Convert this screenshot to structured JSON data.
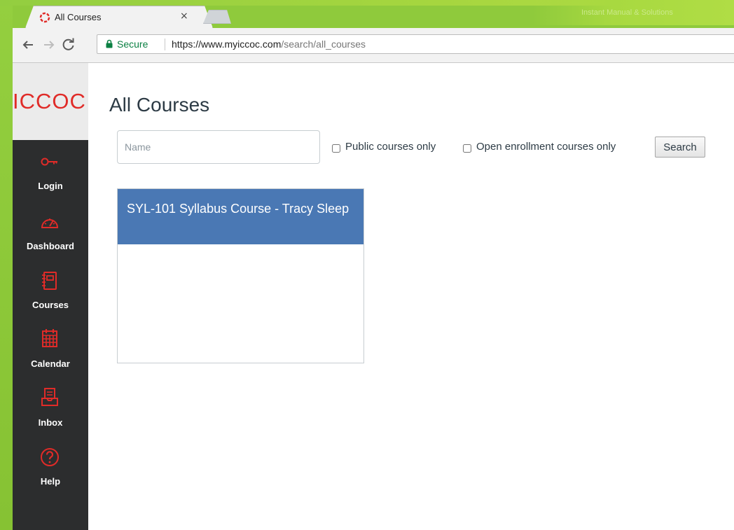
{
  "browser": {
    "tab_title": "All Courses",
    "tab_close": "×",
    "secure_label": "Secure",
    "url_host": "https://www.myiccoc.com",
    "url_path": "/search/all_courses",
    "faded_title_text": "Instant Manual & Solutions"
  },
  "app": {
    "logo_text": "ICCOC",
    "page_title": "All Courses",
    "search_placeholder": "Name",
    "public_only_label": "Public courses only",
    "open_enrollment_label": "Open enrollment courses only",
    "search_button": "Search"
  },
  "sidebar": {
    "items": [
      {
        "label": "Login",
        "icon": "key-icon"
      },
      {
        "label": "Dashboard",
        "icon": "dashboard-gauge-icon"
      },
      {
        "label": "Courses",
        "icon": "book-icon"
      },
      {
        "label": "Calendar",
        "icon": "calendar-icon"
      },
      {
        "label": "Inbox",
        "icon": "inbox-icon"
      },
      {
        "label": "Help",
        "icon": "help-icon"
      }
    ]
  },
  "courses": [
    {
      "title": "SYL-101 Syllabus Course - Tracy Sleep"
    }
  ],
  "colors": {
    "brand_red": "#e02b28",
    "sidebar_bg": "#2c2d2e",
    "course_header": "#4a78b4",
    "secure_green": "#0b8043"
  }
}
